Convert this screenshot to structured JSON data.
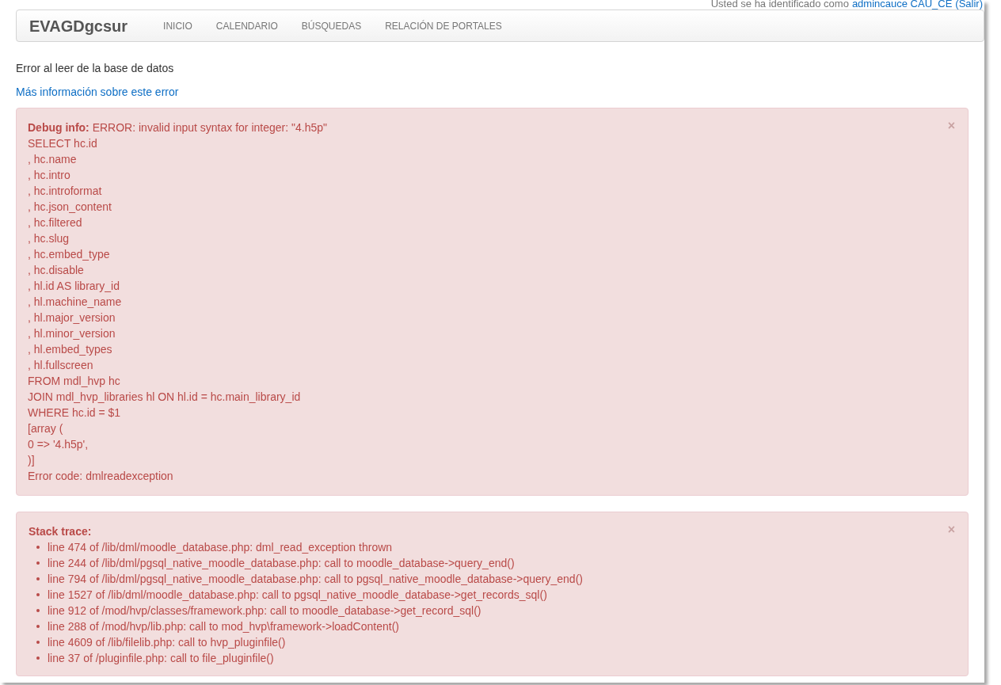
{
  "login_info": {
    "prefix": "Usted se ha identificado como",
    "user_link": "admincauce CAU_CE",
    "logout_link": "(Salir)"
  },
  "navbar": {
    "brand": "EVAGDgcsur",
    "items": [
      {
        "label": "INICIO",
        "selected": false
      },
      {
        "label": "CALENDARIO",
        "selected": false
      },
      {
        "label": "BÚSQUEDAS",
        "selected": false
      },
      {
        "label": "RELACIÓN DE PORTALES",
        "selected": false
      }
    ]
  },
  "error_message": "Error al leer de la base de datos",
  "more_info_link": "Más información sobre este error",
  "debug_alert": {
    "close": "×",
    "lines": [
      "**Debug info:** ERROR: invalid input syntax for integer: \"4.h5p\"",
      "SELECT hc.id",
      ", hc.name",
      ", hc.intro",
      ", hc.introformat",
      ", hc.json_content",
      ", hc.filtered",
      ", hc.slug",
      ", hc.embed_type",
      ", hc.disable",
      ", hl.id AS library_id",
      ", hl.machine_name",
      ", hl.major_version",
      ", hl.minor_version",
      ", hl.embed_types",
      ", hl.fullscreen",
      "FROM mdl_hvp hc",
      "JOIN mdl_hvp_libraries hl ON hl.id = hc.main_library_id",
      "WHERE hc.id = $1",
      "[array (",
      "0 => '4.h5p',",
      ")]",
      "Error code: dmlreadexception"
    ]
  },
  "stack_alert": {
    "close": "×",
    "title": "Stack trace:",
    "items": [
      "line 474 of /lib/dml/moodle_database.php: dml_read_exception thrown",
      "line 244 of /lib/dml/pgsql_native_moodle_database.php: call to moodle_database->query_end()",
      "line 794 of /lib/dml/pgsql_native_moodle_database.php: call to pgsql_native_moodle_database->query_end()",
      "line 1527 of /lib/dml/moodle_database.php: call to pgsql_native_moodle_database->get_records_sql()",
      "line 912 of /mod/hvp/classes/framework.php: call to moodle_database->get_record_sql()",
      "line 288 of /mod/hvp/lib.php: call to mod_hvp\\framework->loadContent()",
      "line 4609 of /lib/filelib.php: call to hvp_pluginfile()",
      "line 37 of /pluginfile.php: call to file_pluginfile()"
    ]
  }
}
